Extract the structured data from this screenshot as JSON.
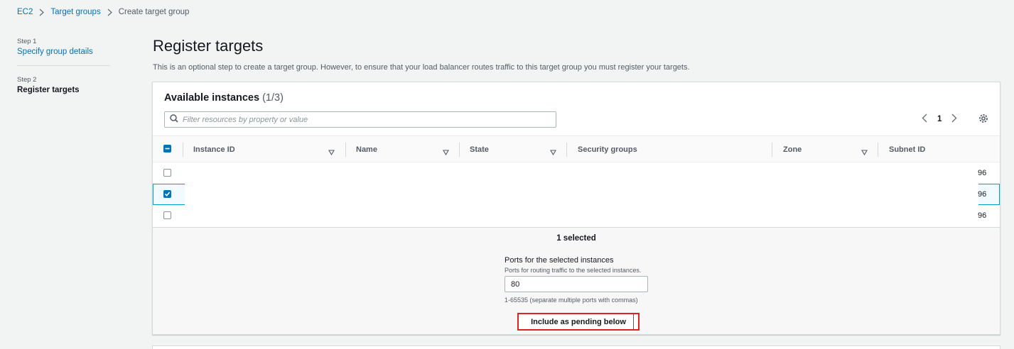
{
  "breadcrumb": {
    "items": [
      "EC2",
      "Target groups"
    ],
    "current": "Create target group"
  },
  "steps": [
    {
      "number": "Step 1",
      "label": "Specify group details"
    },
    {
      "number": "Step 2",
      "label": "Register targets"
    }
  ],
  "page": {
    "title": "Register targets",
    "description": "This is an optional step to create a target group. However, to ensure that your load balancer routes traffic to this target group you must register your targets."
  },
  "instances": {
    "title": "Available instances",
    "count": "(1/3)",
    "search_placeholder": "Filter resources by property or value",
    "page_number": "1",
    "columns": [
      "Instance ID",
      "Name",
      "State",
      "Security groups",
      "Zone",
      "Subnet ID"
    ],
    "rows": [
      {
        "subnet_suffix": "96",
        "checked": false
      },
      {
        "subnet_suffix": "96",
        "checked": true
      },
      {
        "subnet_suffix": "96",
        "checked": false
      }
    ]
  },
  "ports": {
    "selected_text": "1 selected",
    "label": "Ports for the selected instances",
    "help": "Ports for routing traffic to the selected instances.",
    "value": "80",
    "hint": "1-65535 (separate multiple ports with commas)",
    "button_label": "Include as pending below"
  },
  "colors": {
    "link": "#0073bb",
    "accent": "#0073bb",
    "highlight": "#e02222",
    "selected_border": "#00a1c9"
  }
}
